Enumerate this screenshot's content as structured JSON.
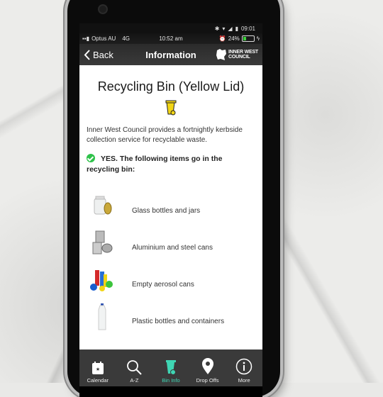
{
  "android_status": {
    "time": "09:01"
  },
  "ios_status": {
    "carrier": "Optus AU",
    "network": "4G",
    "time": "10:52 am",
    "battery": "24%",
    "battery_level": 0.24
  },
  "nav": {
    "back_label": "Back",
    "title": "Information",
    "logo_line1": "INNER WEST",
    "logo_line2": "COUNCIL"
  },
  "page": {
    "heading": "Recycling Bin (Yellow Lid)",
    "description": "Inner West Council provides a fortnightly kerbside collection service for recyclable waste.",
    "yes_text": "YES. The following items go in the recycling bin:",
    "items": [
      {
        "label": "Glass bottles and jars",
        "icon": "glass-jar-icon"
      },
      {
        "label": "Aluminium and steel cans",
        "icon": "cans-icon"
      },
      {
        "label": "Empty aerosol cans",
        "icon": "aerosol-icon"
      },
      {
        "label": "Plastic bottles and containers",
        "icon": "plastic-bottle-icon"
      }
    ]
  },
  "colors": {
    "bin_yellow": "#f2d516",
    "active_tab": "#3fd6b4",
    "check_green": "#2ec24a"
  },
  "tabs": [
    {
      "label": "Calendar",
      "icon": "calendar-icon",
      "active": false
    },
    {
      "label": "A-Z",
      "icon": "search-icon",
      "active": false
    },
    {
      "label": "Bin Info",
      "icon": "bin-icon",
      "active": true
    },
    {
      "label": "Drop Offs",
      "icon": "location-pin-icon",
      "active": false
    },
    {
      "label": "More",
      "icon": "info-icon",
      "active": false
    }
  ]
}
